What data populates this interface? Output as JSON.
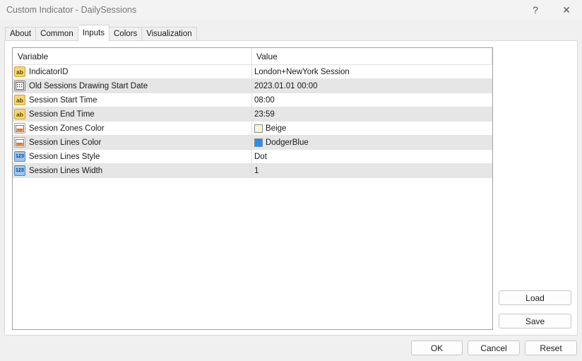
{
  "window": {
    "title": "Custom Indicator - DailySessions",
    "help_label": "?",
    "close_label": "✕"
  },
  "tabs": [
    {
      "label": "About"
    },
    {
      "label": "Common"
    },
    {
      "label": "Inputs"
    },
    {
      "label": "Colors"
    },
    {
      "label": "Visualization"
    }
  ],
  "active_tab": "Inputs",
  "grid": {
    "headers": {
      "variable": "Variable",
      "value": "Value"
    },
    "rows": [
      {
        "icon": "ab-string-icon",
        "variable": "IndicatorID",
        "value": "London+NewYork Session"
      },
      {
        "icon": "calendar-datetime-icon",
        "variable": "Old Sessions Drawing Start Date",
        "value": "2023.01.01 00:00"
      },
      {
        "icon": "ab-string-icon",
        "variable": "Session Start Time",
        "value": "08:00"
      },
      {
        "icon": "ab-string-icon",
        "variable": "Session End Time",
        "value": "23:59"
      },
      {
        "icon": "color-palette-icon",
        "variable": "Session Zones Color",
        "value": "Beige",
        "swatch": "#f5f5dc"
      },
      {
        "icon": "color-palette-icon",
        "variable": "Session Lines Color",
        "value": "DodgerBlue",
        "swatch": "#1e90ff"
      },
      {
        "icon": "numeric-123-icon",
        "variable": "Session Lines Style",
        "value": "Dot"
      },
      {
        "icon": "numeric-123-icon",
        "variable": "Session Lines Width",
        "value": "1"
      }
    ]
  },
  "buttons": {
    "load": "Load",
    "save": "Save",
    "ok": "OK",
    "cancel": "Cancel",
    "reset": "Reset"
  },
  "colors": {
    "window_bg": "#f0f0f0",
    "alt_row": "#e6e6e6",
    "ab_icon": "#f4d774",
    "num_icon": "#9ac6ef"
  }
}
